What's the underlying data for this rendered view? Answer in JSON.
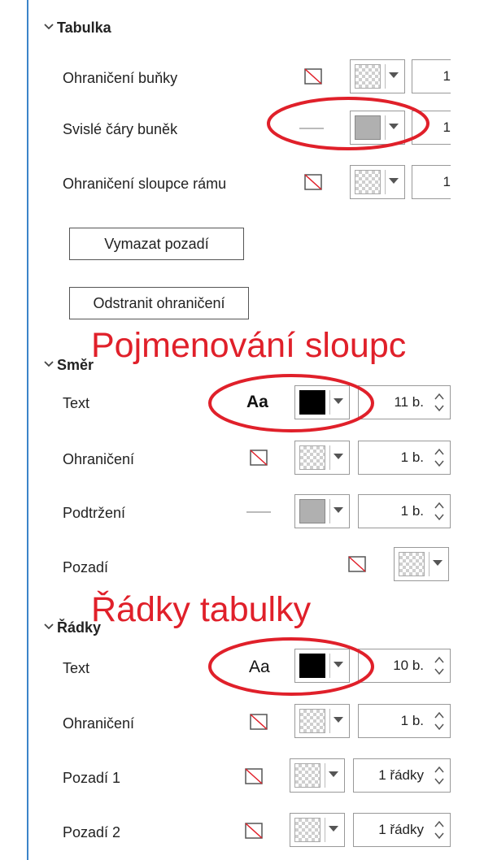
{
  "sections": {
    "tabulka": {
      "header": "Tabulka",
      "rows": [
        {
          "label": "Ohraničení buňky",
          "spin_value": "1"
        },
        {
          "label": "Svislé čáry buněk",
          "spin_value": "1"
        },
        {
          "label": "Ohraničení sloupce rámu",
          "spin_value": "1"
        }
      ],
      "buttons": {
        "clear_background": "Vymazat pozadí",
        "remove_border": "Odstranit ohraničení"
      }
    },
    "smer": {
      "header": "Směr",
      "rows": [
        {
          "label": "Text",
          "icon_text": "Aa",
          "spin_value": "11 b."
        },
        {
          "label": "Ohraničení",
          "spin_value": "1 b."
        },
        {
          "label": "Podtržení",
          "spin_value": "1 b."
        },
        {
          "label": "Pozadí"
        }
      ]
    },
    "radky": {
      "header": "Řádky",
      "rows": [
        {
          "label": "Text",
          "icon_text": "Aa",
          "spin_value": "10 b."
        },
        {
          "label": "Ohraničení",
          "spin_value": "1 b."
        },
        {
          "label": "Pozadí 1",
          "spin_value": "1 řádky"
        },
        {
          "label": "Pozadí 2",
          "spin_value": "1 řádky"
        }
      ]
    }
  },
  "annotations": {
    "column_naming": "Pojmenování sloupc",
    "table_rows": "Řádky tabulky",
    "color": "#e0202a"
  },
  "colors": {
    "accent_edge": "#3c84c9",
    "gray_swatch": "#b0b0b0",
    "black_swatch": "#000000"
  }
}
